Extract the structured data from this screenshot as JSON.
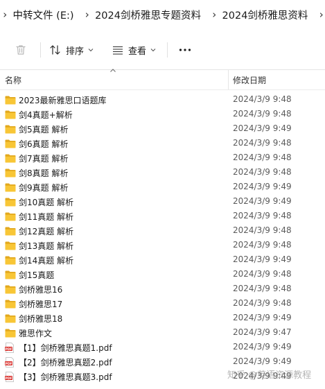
{
  "breadcrumb": {
    "items": [
      "中转文件 (E:)",
      "2024剑桥雅思专题资料",
      "2024剑桥雅思资料"
    ]
  },
  "toolbar": {
    "sort_label": "排序",
    "view_label": "查看"
  },
  "columns": {
    "name": "名称",
    "modified": "修改日期"
  },
  "files": [
    {
      "name": "2023最新雅思口语题库",
      "date": "2024/3/9 9:48",
      "type": "folder"
    },
    {
      "name": "剑4真题+解析",
      "date": "2024/3/9 9:48",
      "type": "folder"
    },
    {
      "name": "剑5真题 解析",
      "date": "2024/3/9 9:49",
      "type": "folder"
    },
    {
      "name": "剑6真题 解析",
      "date": "2024/3/9 9:48",
      "type": "folder"
    },
    {
      "name": "剑7真题 解析",
      "date": "2024/3/9 9:48",
      "type": "folder"
    },
    {
      "name": "剑8真题 解析",
      "date": "2024/3/9 9:48",
      "type": "folder"
    },
    {
      "name": "剑9真题 解析",
      "date": "2024/3/9 9:49",
      "type": "folder"
    },
    {
      "name": "剑10真题 解析",
      "date": "2024/3/9 9:49",
      "type": "folder"
    },
    {
      "name": "剑11真题 解析",
      "date": "2024/3/9 9:48",
      "type": "folder"
    },
    {
      "name": "剑12真题 解析",
      "date": "2024/3/9 9:48",
      "type": "folder"
    },
    {
      "name": "剑13真题 解析",
      "date": "2024/3/9 9:48",
      "type": "folder"
    },
    {
      "name": "剑14真题 解析",
      "date": "2024/3/9 9:49",
      "type": "folder"
    },
    {
      "name": "剑15真题",
      "date": "2024/3/9 9:48",
      "type": "folder"
    },
    {
      "name": "剑桥雅思16",
      "date": "2024/3/9 9:48",
      "type": "folder"
    },
    {
      "name": "剑桥雅思17",
      "date": "2024/3/9 9:48",
      "type": "folder"
    },
    {
      "name": "剑桥雅思18",
      "date": "2024/3/9 9:49",
      "type": "folder"
    },
    {
      "name": "雅思作文",
      "date": "2024/3/9 9:47",
      "type": "folder"
    },
    {
      "name": "【1】剑桥雅思真题1.pdf",
      "date": "2024/3/9 9:49",
      "type": "pdf"
    },
    {
      "name": "【2】剑桥雅思真题2.pdf",
      "date": "2024/3/9 9:49",
      "type": "pdf"
    },
    {
      "name": "【3】剑桥雅思真题3.pdf",
      "date": "2024/3/9 9:49",
      "type": "pdf"
    }
  ],
  "watermark": "知乎 @英语资源教程",
  "colors": {
    "folder": "#F8C636",
    "folder_dark": "#E2A81E",
    "pdf": "#D9322E"
  },
  "icons": {
    "folder": "folder-icon",
    "pdf": "pdf-icon",
    "delete": "trash-icon",
    "sort": "sort-icon",
    "view": "view-icon",
    "more": "more-icon"
  }
}
